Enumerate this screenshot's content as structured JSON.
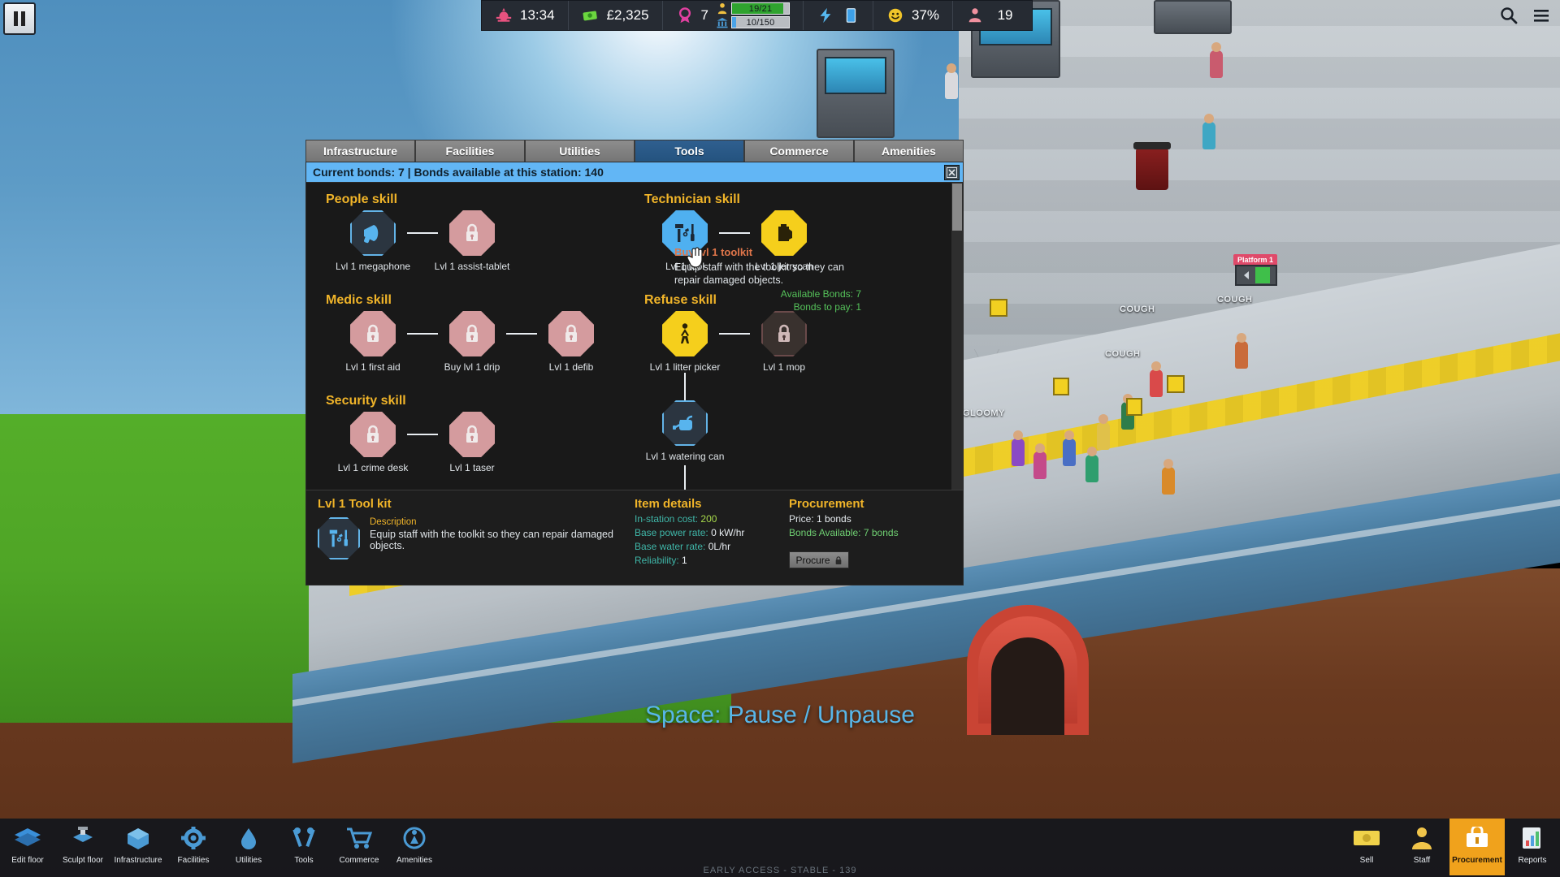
{
  "hud": {
    "pause_label": "pause-button",
    "clock": {
      "icon": "sunrise-icon",
      "value": "13:34"
    },
    "money": {
      "icon": "cash-icon",
      "value": "£2,325"
    },
    "award": {
      "icon": "rosette-icon",
      "value": "7"
    },
    "staff_bar": {
      "icon": "person-icon",
      "value": "19/21",
      "fill_pct": 90,
      "color": "#2fa32f"
    },
    "station_bar": {
      "icon": "station-icon",
      "value": "10/150",
      "fill_pct": 7,
      "color": "#4aa3e8"
    },
    "power": {
      "icon": "lightning-icon"
    },
    "water": {
      "icon": "water-tank-icon"
    },
    "happiness": {
      "icon": "smiley-icon",
      "value": "37%"
    },
    "passengers": {
      "icon": "passenger-icon",
      "value": "19"
    },
    "search_icon": "search-icon",
    "menu_icon": "hamburger-menu-icon"
  },
  "modal": {
    "tabs": [
      {
        "label": "Infrastructure",
        "active": false
      },
      {
        "label": "Facilities",
        "active": false
      },
      {
        "label": "Utilities",
        "active": false
      },
      {
        "label": "Tools",
        "active": true
      },
      {
        "label": "Commerce",
        "active": false
      },
      {
        "label": "Amenities",
        "active": false
      }
    ],
    "title": "Current bonds: 7 | Bonds available at this station: 140",
    "close_icon": "close-icon",
    "groups_left": [
      {
        "heading": "People skill",
        "nodes": [
          {
            "label": "Lvl 1 megaphone",
            "state": "owned",
            "icon": "megaphone-icon"
          },
          {
            "label": "Lvl 1 assist-tablet",
            "state": "locked",
            "icon": "lock-icon"
          }
        ]
      },
      {
        "heading": "Medic skill",
        "nodes": [
          {
            "label": "Lvl 1 first aid",
            "state": "locked",
            "icon": "lock-icon"
          },
          {
            "label": "Buy lvl 1 drip",
            "state": "locked",
            "icon": "lock-icon"
          },
          {
            "label": "Lvl 1 defib",
            "state": "locked",
            "icon": "lock-icon"
          }
        ]
      },
      {
        "heading": "Security skill",
        "nodes": [
          {
            "label": "Lvl 1 crime desk",
            "state": "locked",
            "icon": "lock-icon"
          },
          {
            "label": "Lvl 1 taser",
            "state": "locked",
            "icon": "lock-icon"
          }
        ]
      }
    ],
    "groups_right": [
      {
        "heading": "Technician skill",
        "nodes": [
          {
            "label": "Lvl 1 tool",
            "state": "avail",
            "icon": "toolkit-icon"
          },
          {
            "label": "Lvl 1 jerrycan",
            "state": "yellow",
            "icon": "jerrycan-icon"
          }
        ]
      },
      {
        "heading": "Refuse skill",
        "nodes": [
          {
            "label": "Lvl 1 litter picker",
            "state": "yellow",
            "icon": "litter-picker-icon"
          },
          {
            "label": "Lvl 1 mop",
            "state": "dark",
            "icon": "lock-icon"
          }
        ],
        "child": {
          "label": "Lvl 1 watering can",
          "state": "owned",
          "icon": "watering-can-icon"
        }
      }
    ],
    "tooltip": {
      "title": "Buy lvl 1 toolkit",
      "description": "Equip staff with the toolkit so they can repair damaged objects.",
      "available_bonds_label": "Available Bonds:",
      "available_bonds_value": "7",
      "bonds_to_pay_label": "Bonds to pay:",
      "bonds_to_pay_value": "1"
    },
    "footer": {
      "item_name": "Lvl 1 Tool kit",
      "item_icon": "toolkit-icon",
      "description_label": "Description",
      "description_text": "Equip staff with the toolkit so they can repair damaged objects.",
      "details_title": "Item details",
      "details": [
        {
          "label": "In-station cost:",
          "value": "200",
          "value_style": "green"
        },
        {
          "label": "Base power rate:",
          "value": "0 kW/hr",
          "value_style": "white"
        },
        {
          "label": "Base water rate:",
          "value": "0L/hr",
          "value_style": "white"
        },
        {
          "label": "Reliability:",
          "value": "1",
          "value_style": "white"
        }
      ],
      "procurement_title": "Procurement",
      "price_label": "Price:",
      "price_value": "1 bonds",
      "bonds_label": "Bonds Available:",
      "bonds_value": "7 bonds",
      "procure_button": "Procure",
      "procure_icon": "lock-icon"
    }
  },
  "world": {
    "hint": "Space: Pause / Unpause",
    "version": "EARLY ACCESS - STABLE - 139",
    "platform_sign": "Platform 1",
    "bubbles": [
      "COUGH",
      "COUGH",
      "COUGH",
      "GLOOMY"
    ]
  },
  "toolbar": {
    "items": [
      {
        "label": "Edit floor",
        "icon": "edit-floor-icon",
        "active": false
      },
      {
        "label": "Sculpt floor",
        "icon": "sculpt-floor-icon",
        "active": false
      },
      {
        "label": "Infrastructure",
        "icon": "infrastructure-icon",
        "active": false
      },
      {
        "label": "Facilities",
        "icon": "facilities-icon",
        "active": false
      },
      {
        "label": "Utilities",
        "icon": "utilities-icon",
        "active": false
      },
      {
        "label": "Tools",
        "icon": "tools-icon",
        "active": false
      },
      {
        "label": "Commerce",
        "icon": "commerce-icon",
        "active": false
      },
      {
        "label": "Amenities",
        "icon": "amenities-icon",
        "active": false
      }
    ],
    "right_items": [
      {
        "label": "Sell",
        "icon": "sell-icon",
        "active": false
      },
      {
        "label": "Staff",
        "icon": "staff-icon",
        "active": false
      },
      {
        "label": "Procurement",
        "icon": "procurement-icon",
        "active": true
      },
      {
        "label": "Reports",
        "icon": "reports-icon",
        "active": false
      }
    ]
  },
  "colors": {
    "accent": "#f0b429",
    "tooltip_title": "#e0764a",
    "title_bar": "#62b6f5",
    "green": "#a6d84a",
    "teal": "#3fb6a8"
  }
}
